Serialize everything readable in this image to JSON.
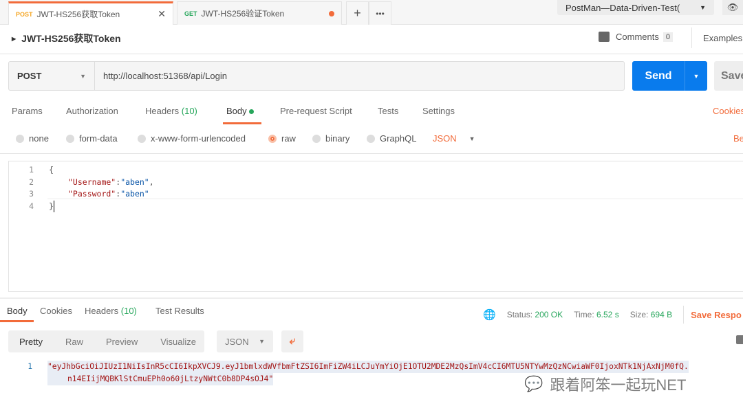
{
  "tabs": [
    {
      "method": "POST",
      "name": "JWT-HS256获取Token"
    },
    {
      "method": "GET",
      "name": "JWT-HS256验证Token"
    }
  ],
  "environment": "PostMan—Data-Driven-Test(",
  "request_title": "JWT-HS256获取Token",
  "comments_label": "Comments",
  "comments_count": "0",
  "examples_label": "Examples",
  "method": "POST",
  "url": "http://localhost:51368/api/Login",
  "send_label": "Send",
  "save_label": "Save",
  "req_tabs": {
    "params": "Params",
    "auth": "Authorization",
    "headers": "Headers",
    "headers_count": "(10)",
    "body": "Body",
    "prereq": "Pre-request Script",
    "tests": "Tests",
    "settings": "Settings",
    "cookies": "Cookies"
  },
  "body_types": [
    "none",
    "form-data",
    "x-www-form-urlencoded",
    "raw",
    "binary",
    "GraphQL"
  ],
  "body_format": "JSON",
  "beautify": "Be",
  "editor_lines": [
    {
      "n": "1",
      "t": "{"
    },
    {
      "n": "2",
      "k": "\"Username\"",
      "s": ": ",
      "v": "\"aben\"",
      "e": ","
    },
    {
      "n": "3",
      "k": "\"Password\"",
      "s": ":",
      "v": "\"aben\"",
      "e": ""
    },
    {
      "n": "4",
      "t": "}"
    }
  ],
  "resp_tabs": {
    "body": "Body",
    "cookies": "Cookies",
    "headers": "Headers",
    "headers_count": "(10)",
    "tests": "Test Results"
  },
  "status_label": "Status:",
  "status": "200 OK",
  "time_label": "Time:",
  "time": "6.52 s",
  "size_label": "Size:",
  "size": "694 B",
  "save_response": "Save Respo",
  "view_modes": [
    "Pretty",
    "Raw",
    "Preview",
    "Visualize"
  ],
  "resp_format": "JSON",
  "response": {
    "line": "1",
    "l1": "\"eyJhbGciOiJIUzI1NiIsInR5cCI6IkpXVCJ9.eyJ1bmlxdWVfbmFtZSI6ImFiZW4iLCJuYmYiOjE1OTU2MDE2MzQsImV4cCI6MTU5NTYwMzQzNCwiaWF0IjoxNTk1NjAxNjM0fQ.",
    "l2": "n14EIijMQBKlStCmuEPh0o60jLtzyNWtC0b8DP4sOJ4\""
  },
  "watermark": "跟着阿笨一起玩NET"
}
